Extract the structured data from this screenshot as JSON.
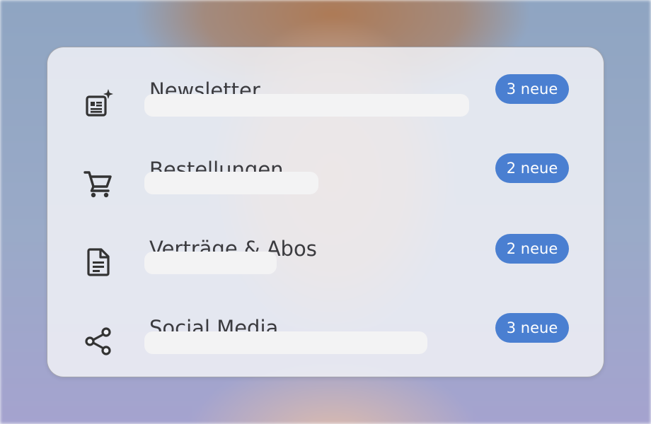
{
  "rows": [
    {
      "icon": "newsletter-icon",
      "title": "Newsletter",
      "badge": "3 neue"
    },
    {
      "icon": "cart-icon",
      "title": "Bestellungen",
      "badge": "2 neue"
    },
    {
      "icon": "document-icon",
      "title": "Verträge & Abos",
      "badge": "2 neue"
    },
    {
      "icon": "share-icon",
      "title": "Social Media",
      "badge": "3 neue"
    }
  ],
  "colors": {
    "badge": "#4a7fd1",
    "icon": "#333333",
    "card": "#f0f1f6"
  }
}
